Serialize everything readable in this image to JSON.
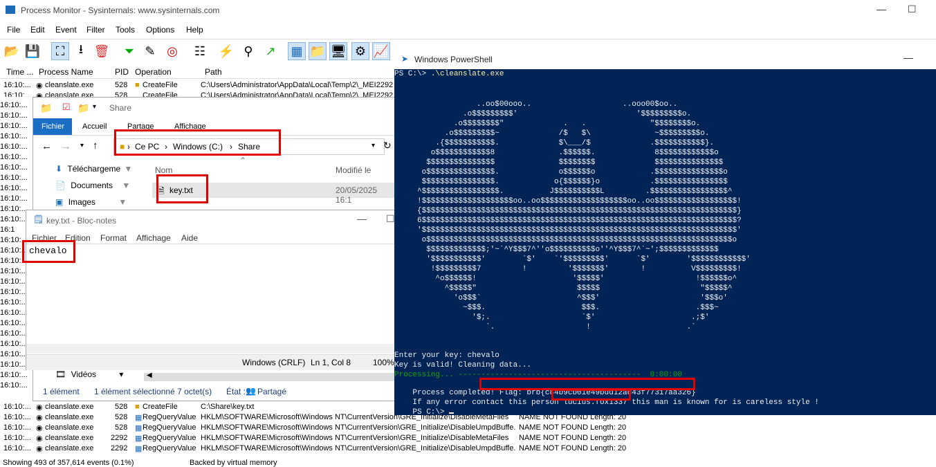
{
  "procmon": {
    "title": "Process Monitor - Sysinternals: www.sysinternals.com",
    "menu": [
      "File",
      "Edit",
      "Event",
      "Filter",
      "Tools",
      "Options",
      "Help"
    ],
    "columns": [
      "Time ...",
      "Process Name",
      "PID",
      "Operation",
      "Path"
    ],
    "top_rows": [
      {
        "time": "16:10:...",
        "proc": "cleanslate.exe",
        "pid": "528",
        "op": "CreateFile",
        "path": "C:\\Users\\Administrator\\AppData\\Local\\Temp\\2\\_MEI2292"
      },
      {
        "time": "16:10:...",
        "proc": "cleanslate.exe",
        "pid": "528",
        "op": "CreateFile",
        "path": "C:\\Users\\Administrator\\AppData\\Local\\Temp\\2\\_MEI2292"
      }
    ],
    "time_fillers": [
      "16:10:...",
      "16:10:...",
      "16:10:...",
      "16:10:...",
      "16:10:...",
      "16:10:...",
      "16:10:...",
      "16:10:...",
      "16:10:...",
      "16:10:...",
      "16:10:...",
      "16:10:...",
      "16:1",
      "16:10:...",
      "16:10:...",
      "16:10:...",
      "16:10:...",
      "16:10:...",
      "16:10:...",
      "16:10:...",
      "16:10:...",
      "16:10:...",
      "16:10:...",
      "16:10:...",
      "16:10:...",
      "16:10:...",
      "16:10:...",
      "16:10:..."
    ],
    "bottom_rows": [
      {
        "time": "16:10:...",
        "proc": "cleanslate.exe",
        "pid": "528",
        "op": "CreateFile",
        "path": "C:\\Share\\key.txt",
        "result": ""
      },
      {
        "time": "16:10:...",
        "proc": "cleanslate.exe",
        "pid": "528",
        "op": "RegQueryValue",
        "path": "HKLM\\SOFTWARE\\Microsoft\\Windows NT\\CurrentVersion\\GRE_Initialize\\DisableMetaFiles",
        "result": "NAME NOT FOUND Length: 20"
      },
      {
        "time": "16:10:...",
        "proc": "cleanslate.exe",
        "pid": "528",
        "op": "RegQueryValue",
        "path": "HKLM\\SOFTWARE\\Microsoft\\Windows NT\\CurrentVersion\\GRE_Initialize\\DisableUmpdBuffe...",
        "result": "NAME NOT FOUND Length: 20"
      },
      {
        "time": "16:10:...",
        "proc": "cleanslate.exe",
        "pid": "2292",
        "op": "RegQueryValue",
        "path": "HKLM\\SOFTWARE\\Microsoft\\Windows NT\\CurrentVersion\\GRE_Initialize\\DisableMetaFiles",
        "result": "NAME NOT FOUND Length: 20"
      },
      {
        "time": "16:10:...",
        "proc": "cleanslate.exe",
        "pid": "2292",
        "op": "RegQueryValue",
        "path": "HKLM\\SOFTWARE\\Microsoft\\Windows NT\\CurrentVersion\\GRE_Initialize\\DisableUmpdBuffe...",
        "result": "NAME NOT FOUND Length: 20"
      }
    ],
    "status_left": "Showing 493 of 357,614 events (0.1%)",
    "status_right": "Backed by virtual memory"
  },
  "explorer": {
    "title": "Share",
    "tabs": [
      "Fichier",
      "Accueil",
      "Partage",
      "Affichage"
    ],
    "breadcrumb": [
      "Ce PC",
      "Windows (C:)",
      "Share"
    ],
    "nav": [
      "Téléchargeme",
      "Documents",
      "Images",
      "Vidéos"
    ],
    "col_name": "Nom",
    "col_modified": "Modifié le",
    "file_name": "key.txt",
    "file_date": "20/05/2025 16:1",
    "status_count": "1 élément",
    "status_selected": "1 élément sélectionné  7 octet(s)",
    "status_state": "État :",
    "status_share": "Partagé"
  },
  "notepad": {
    "title": "key.txt - Bloc-notes",
    "menu": [
      "Fichier",
      "Edition",
      "Format",
      "Affichage",
      "Aide"
    ],
    "content": "chevalo",
    "status_eol": "Windows (CRLF)",
    "status_pos": "Ln 1, Col 8",
    "status_zoom": "100%"
  },
  "powershell": {
    "title": "Windows PowerShell",
    "prompt": "PS C:\\> ",
    "command": ".\\cleanslate.exe",
    "ascii_art": "                  ..oo$00ooo..                    ..ooo00$oo..\n               .o$$$$$$$$$'                          '$$$$$$$$$o.\n             .o$$$$$$$$\"             .   .              \"$$$$$$$$o.\n           .o$$$$$$$$$~             /$   $\\              ~$$$$$$$$$o.\n         .{$$$$$$$$$$$.             $\\___/$             .$$$$$$$$$$$}.\n        o$$$$$$$$$$$$8              .$$$$$$.             8$$$$$$$$$$$$o\n       $$$$$$$$$$$$$$$              $$$$$$$$             $$$$$$$$$$$$$$$\n      o$$$$$$$$$$$$$$$.             o$$$$$$o            .$$$$$$$$$$$$$$$o\n      $$$$$$$$$$$$$$$$.            o{$$$$$$}o           .$$$$$$$$$$$$$$$$\n     ^$$$$$$$$$$$$$$$$$.          J$$$$$$$$$$L         .$$$$$$$$$$$$$$$$$^\n     !$$$$$$$$$$$$$$$$$$$$oo..oo$$$$$$$$$$$$$$$$$$$oo..oo$$$$$$$$$$$$$$$$$$!\n     {$$$$$$$$$$$$$$$$$$$$$$$$$$$$$$$$$$$$$$$$$$$$$$$$$$$$$$$$$$$$$$$$$$$$$}\n     6$$$$$$$$$$$$$$$$$$$$$$$$$$$$$$$$$$$$$$$$$$$$$$$$$$$$$$$$$$$$$$$$$$$$$?\n     '$$$$$$$$$$$$$$$$$$$$$$$$$$$$$$$$$$$$$$$$$$$$$$$$$$$$$$$$$$$$$$$$$$$$$'\n      o$$$$$$$$$$$$$$$$$$$$$$$$$$$$$$$$$$$$$$$$$$$$$$$$$$$$$$$$$$$$$$$$$$$o\n       $$$$$$$$$$$$$;'~`^Y$$$7^''o$$$$$$$$$$o''^Y$$$7^`~';$$$$$$$$$$$$$\n       '$$$$$$$$$$$'        `$'    `'$$$$$$$$$'      `$'        '$$$$$$$$$$$$'\n        !$$$$$$$$$7         !         '$$$$$$$'       !          V$$$$$$$$$!\n         ^o$$$$$$!                     '$$$$$'                    !$$$$$$o^\n           ^$$$$$\"                      $$$$$                      \"$$$$$^\n             'o$$$`                     ^$$$'                      '$$$o'\n               ~$$$.                     $$$.                     .$$$~\n                 '$;.                    `$'                     .;$'\n                    `.                    !                     .`",
    "processing": "Processing... ----------------------------------------  0:00:00",
    "lines": [
      "Enter your key: chevalo",
      "Key is valid! Cleaning data..."
    ],
    "completed_prefix": "Process completed! ",
    "flag": "Flag: brb{c84b9cb01e49bdd12ad43f77317aa326}",
    "contact_prefix": "If any error contact this person ",
    "contact_user": "lucius.fox1337",
    "contact_suffix": " this man is known for is careless style !",
    "final_prompt": "PS C:\\> "
  }
}
